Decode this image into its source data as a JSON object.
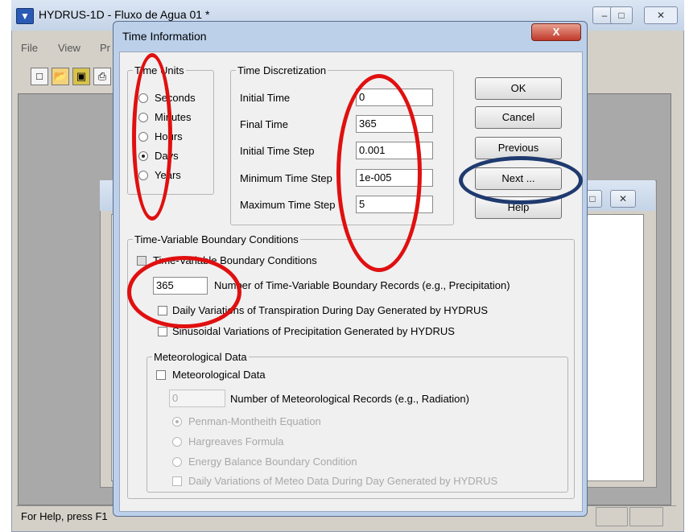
{
  "main_window": {
    "title": "HYDRUS-1D - Fluxo de Agua 01 *",
    "menu": [
      "File",
      "View",
      "Pr"
    ],
    "toolbar_icons": [
      "new-file-icon",
      "open-folder-icon",
      "save-icon",
      "print-icon"
    ],
    "status_text": "For Help, press F1"
  },
  "dialog": {
    "title": "Time Information",
    "close_label": "X",
    "time_units": {
      "legend": "Time Units",
      "options": [
        "Seconds",
        "Minutes",
        "Hours",
        "Days",
        "Years"
      ],
      "selected": "Days"
    },
    "time_discretization": {
      "legend": "Time Discretization",
      "initial_time_label": "Initial Time",
      "initial_time": "0",
      "final_time_label": "Final Time",
      "final_time": "365",
      "initial_step_label": "Initial Time Step",
      "initial_step": "0.001",
      "min_step_label": "Minimum Time Step",
      "min_step": "1e-005",
      "max_step_label": "Maximum Time Step",
      "max_step": "5"
    },
    "buttons": {
      "ok": "OK",
      "cancel": "Cancel",
      "previous": "Previous",
      "next": "Next ...",
      "help": "Help"
    },
    "boundary": {
      "legend": "Time-Variable Boundary Conditions",
      "checkbox_label": "Time-Variable Boundary Conditions",
      "records_value": "365",
      "records_label": "Number of Time-Variable Boundary Records (e.g., Precipitation)",
      "daily_transpiration_label": "Daily Variations of Transpiration During Day Generated by HYDRUS",
      "sinusoidal_label": "Sinusoidal Variations of Precipitation Generated by HYDRUS"
    },
    "meteo": {
      "legend": "Meteorological Data",
      "checkbox_label": "Meteorological Data",
      "records_value": "0",
      "records_label": "Number of Meteorological Records (e.g., Radiation)",
      "methods": [
        "Penman-Montheith Equation",
        "Hargreaves Formula",
        "Energy Balance Boundary Condition"
      ],
      "selected_method": "Penman-Montheith Equation",
      "daily_meteo_label": "Daily Variations of Meteo Data During Day Generated by HYDRUS"
    }
  },
  "annotation_colors": {
    "red": "#e01010",
    "navy": "#1f3a6e"
  }
}
